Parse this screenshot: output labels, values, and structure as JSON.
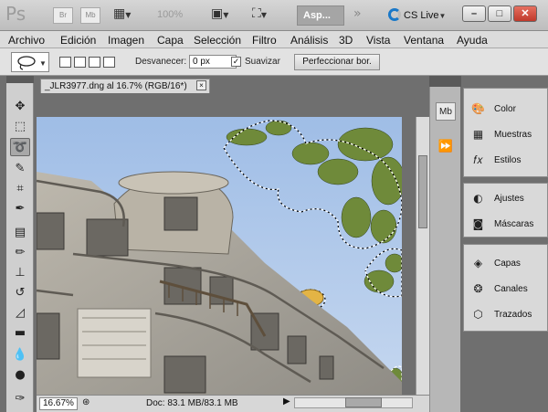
{
  "app": {
    "logo": "Ps",
    "bridge_btn": "Br",
    "minibridge_btn": "Mb",
    "zoom": "100%",
    "workspace": "Asp...",
    "cs_live": "CS Live",
    "win_min": "–",
    "win_max": "□",
    "win_close": "✕"
  },
  "menu": [
    "Archivo",
    "Edición",
    "Imagen",
    "Capa",
    "Selección",
    "Filtro",
    "Análisis",
    "3D",
    "Vista",
    "Ventana",
    "Ayuda"
  ],
  "options": {
    "feather_label": "Desvanecer:",
    "feather_value": "0 px",
    "antialias_label": "Suavizar",
    "antialias_check": "✓",
    "refine_button": "Perfeccionar bor."
  },
  "document": {
    "tab_title": "_JLR3977.dng al 16.7% (RGB/16*)",
    "tab_close": "×"
  },
  "status": {
    "zoom": "16.67%",
    "doc_info": "Doc: 83.1 MB/83.1 MB"
  },
  "panels": {
    "strip_mb": "Mb",
    "group1": [
      {
        "icon": "color-icon",
        "label": "Color"
      },
      {
        "icon": "swatches-icon",
        "label": "Muestras"
      },
      {
        "icon": "styles-icon",
        "label": "Estilos"
      }
    ],
    "group2": [
      {
        "icon": "adjustments-icon",
        "label": "Ajustes"
      },
      {
        "icon": "masks-icon",
        "label": "Máscaras"
      }
    ],
    "group3": [
      {
        "icon": "layers-icon",
        "label": "Capas"
      },
      {
        "icon": "channels-icon",
        "label": "Canales"
      },
      {
        "icon": "paths-icon",
        "label": "Trazados"
      }
    ]
  },
  "tools": [
    "move-tool",
    "marquee-tool",
    "lasso-tool",
    "quick-selection-tool",
    "crop-tool",
    "eyedropper-tool",
    "spot-healing-tool",
    "brush-tool",
    "clone-stamp-tool",
    "history-brush-tool",
    "eraser-tool",
    "gradient-tool",
    "blur-tool",
    "dodge-tool",
    "pen-tool"
  ],
  "colors": {
    "accent": "#1a78c8",
    "sky": "#b7cdea",
    "selected_tool": "#a8a8a8"
  }
}
